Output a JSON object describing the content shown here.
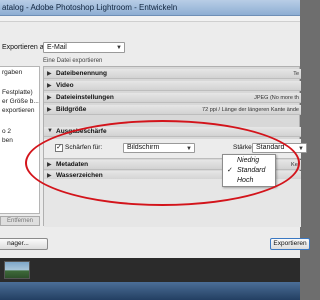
{
  "window": {
    "title": "atalog - Adobe Photoshop Lightroom - Entwickeln"
  },
  "top": {
    "label": "Exportieren auf:",
    "destination": "E-Mail",
    "info": "Eine Datei exportieren"
  },
  "left_panel": {
    "items": [
      "rgaben",
      "Festplatte)",
      "er Größe b...",
      "exportieren",
      "o 2",
      "ben"
    ],
    "remove_label": "Entfernen"
  },
  "sections": [
    {
      "name": "Dateibenennung",
      "info": "Te"
    },
    {
      "name": "Video",
      "info": ""
    },
    {
      "name": "Dateieinstellungen",
      "info": "JPEG (No more th"
    },
    {
      "name": "Bildgröße",
      "info": "72 ppi / Länge der längeren Kante ände"
    },
    {
      "name": "Ausgabeschärfe",
      "info": ""
    },
    {
      "name": "Metadaten",
      "info": "Kei"
    },
    {
      "name": "Wasserzeichen",
      "info": ""
    }
  ],
  "sharpen": {
    "checkbox_checked": true,
    "sharpen_for_label": "Schärfen für:",
    "sharpen_for_value": "Bildschirm",
    "strength_label": "Stärke:",
    "strength_value": "Standard"
  },
  "dropdown": {
    "options": [
      "Niedrig",
      "Standard",
      "Hoch"
    ],
    "selected": "Standard",
    "check_glyph": "✓"
  },
  "buttons": {
    "manager": "nager...",
    "export": "Exportieren"
  },
  "colors": {
    "highlight_ellipse": "#d3141b",
    "export_button_border": "#3b78c2"
  }
}
